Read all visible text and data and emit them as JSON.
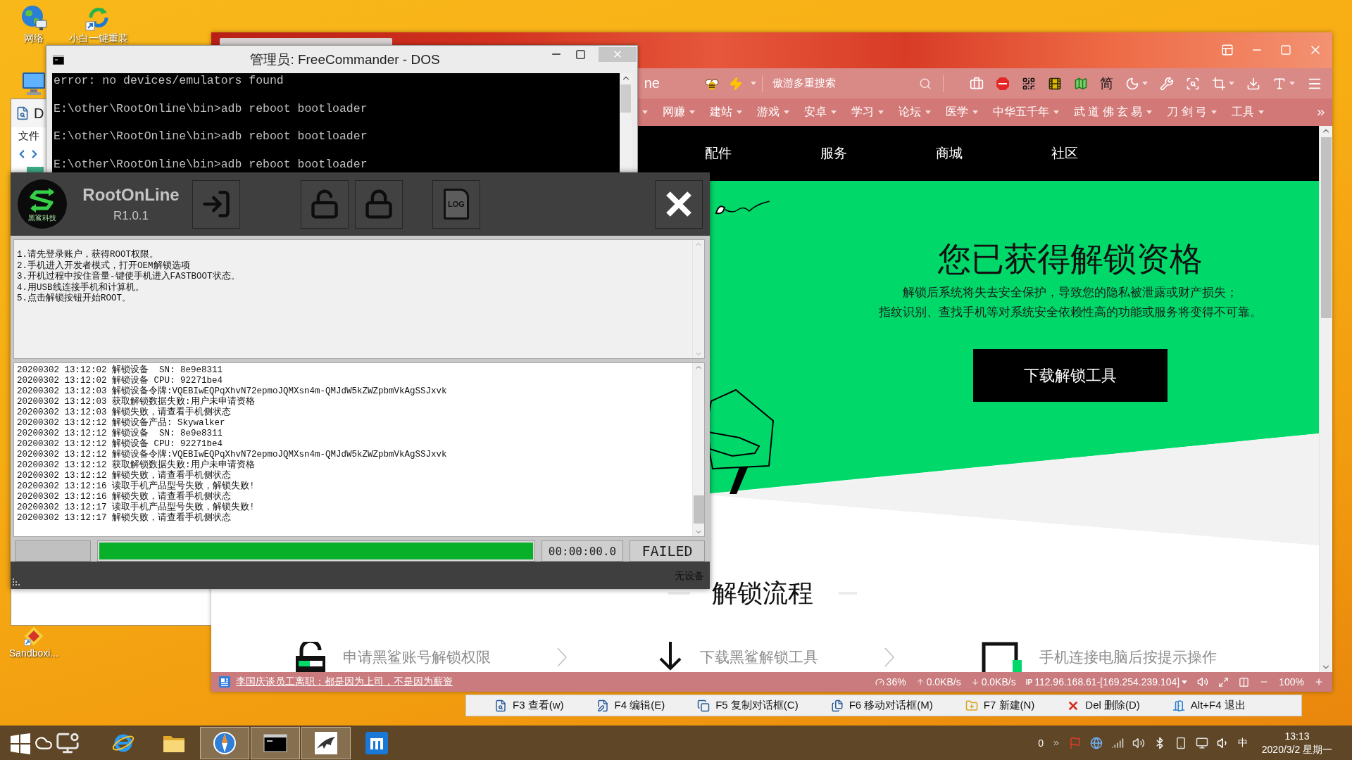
{
  "desktop": {
    "icons": [
      {
        "kind": "network",
        "label": "网络"
      },
      {
        "kind": "installer",
        "label": "小白一键重装"
      },
      {
        "kind": "computer"
      },
      {
        "kind": "sandbox",
        "label": "Sandboxi..."
      }
    ]
  },
  "explorer_window": {
    "title": "D",
    "menu": "文件"
  },
  "browser": {
    "address": "ne",
    "search_placeholder": "傲游多重搜索",
    "language": "简",
    "bookmarks": [
      {
        "label": "网赚"
      },
      {
        "label": "建站"
      },
      {
        "label": "游戏"
      },
      {
        "label": "安卓"
      },
      {
        "label": "学习"
      },
      {
        "label": "论坛"
      },
      {
        "label": "医学"
      },
      {
        "label": "中华五千年"
      },
      {
        "label": "武 道 佛 玄 易"
      },
      {
        "label": "刀 剑 弓"
      },
      {
        "label": "工具"
      }
    ],
    "nav": [
      "配件",
      "服务",
      "商城",
      "社区"
    ],
    "title": "您已获得解锁资格",
    "notice": [
      "解锁后系统将失去安全保护，导致您的隐私被泄露或财产损失；",
      "指纹识别、查找手机等对系统安全依赖性高的功能或服务将变得不可靠。"
    ],
    "download_button": "下载解锁工具",
    "section_title": "解锁流程",
    "steps": [
      {
        "kind": "apply",
        "label": "申请黑鲨账号解锁权限"
      },
      {
        "kind": "download",
        "label": "下载黑鲨解锁工具"
      },
      {
        "kind": "connect",
        "label": "手机连接电脑后按提示操作"
      }
    ],
    "status_bar": {
      "news": "李国庆谈员工离职：都是因为上司，不是因为薪资",
      "cpu": "36%",
      "upload": "0.0KB/s",
      "download": "0.0KB/s",
      "ip_label": "IP",
      "ip": "112.96.168.61-[169.254.239.104]",
      "zoom": "100%"
    }
  },
  "commander_bar": {
    "keys": [
      {
        "kind": "view",
        "label": "F3 查看(w)"
      },
      {
        "kind": "edit",
        "label": "F4 编辑(E)"
      },
      {
        "kind": "copy",
        "label": "F5 复制对话框(C)"
      },
      {
        "kind": "move",
        "label": "F6 移动对话框(M)"
      },
      {
        "kind": "new",
        "label": "F7 新建(N)"
      },
      {
        "kind": "delete",
        "label": "Del 删除(D)"
      },
      {
        "kind": "exit",
        "label": "Alt+F4 退出"
      }
    ]
  },
  "dos_window": {
    "title": "管理员: FreeCommander - DOS",
    "lines": [
      "error: no devices/emulators found",
      "E:\\other\\RootOnline\\bin>adb reboot bootloader",
      "E:\\other\\RootOnline\\bin>adb reboot bootloader",
      "E:\\other\\RootOnline\\bin>adb reboot bootloader"
    ]
  },
  "rootonline": {
    "name": "RootOnLine",
    "version": "R1.0.1",
    "logo_caption": "黑鲨科技",
    "tools": [
      {
        "kind": "login"
      },
      {
        "kind": "unlock"
      },
      {
        "kind": "lock"
      },
      {
        "kind": "log",
        "label": "LOG"
      }
    ],
    "instructions": [
      "1.请先登录账户，获得ROOT权限。",
      "2.手机进入开发者模式，打开OEM解锁选项",
      "3.开机过程中按住音量-键使手机进入FASTBOOT状态。",
      "4.用USB线连接手机和计算机。",
      "5.点击解锁按钮开始ROOT。"
    ],
    "log": [
      "20200302 13:12:02 解锁设备  SN: 8e9e8311",
      "20200302 13:12:02 解锁设备 CPU: 92271be4",
      "20200302 13:12:03 解锁设备令牌:VQEBIwEQPqXhvN72epmoJQMXsn4m-QMJdW5kZWZpbmVkAgSSJxvk",
      "20200302 13:12:03 获取解锁数据失败:用户未申请资格",
      "20200302 13:12:03 解锁失败，请查看手机侧状态",
      "20200302 13:12:12 解锁设备产品: Skywalker",
      "20200302 13:12:12 解锁设备  SN: 8e9e8311",
      "20200302 13:12:12 解锁设备 CPU: 92271be4",
      "20200302 13:12:12 解锁设备令牌:VQEBIwEQPqXhvN72epmoJQMXsn4m-QMJdW5kZWZpbmVkAgSSJxvk",
      "20200302 13:12:12 获取解锁数据失败:用户未申请资格",
      "20200302 13:12:12 解锁失败，请查看手机侧状态",
      "20200302 13:12:16 读取手机产品型号失败，解锁失败!",
      "20200302 13:12:16 解锁失败，请查看手机侧状态",
      "20200302 13:12:17 读取手机产品型号失败，解锁失败!",
      "20200302 13:12:17 解锁失败，请查看手机侧状态"
    ],
    "progress": {
      "level": 1
    },
    "elapsed": "00:00:00.0",
    "result": "FAILED",
    "status": "无设备"
  },
  "taskbar": {
    "apps": [
      {
        "kind": "ie",
        "running": false
      },
      {
        "kind": "folder",
        "running": false
      },
      {
        "kind": "compass",
        "running": true
      },
      {
        "kind": "console",
        "running": true
      },
      {
        "kind": "shark",
        "running": true
      },
      {
        "kind": "maxthon",
        "running": false
      }
    ],
    "tray_count": "0",
    "ime": "中",
    "time": "13:13",
    "date": "2020/3/2 星期一"
  }
}
